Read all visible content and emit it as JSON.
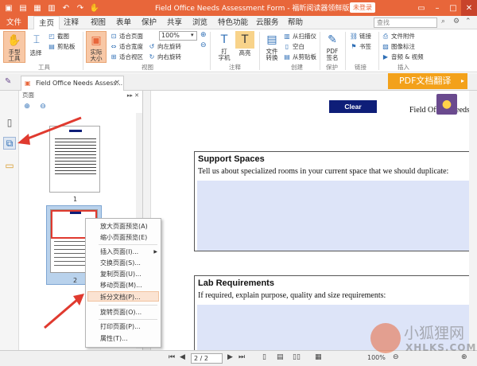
{
  "titlebar": {
    "title": "Field Office Needs Assessment Form - 福昕阅读器领鲜版",
    "login": "未登录",
    "icons": [
      "app-logo-icon",
      "open-icon",
      "save-icon",
      "print-icon",
      "undo-icon",
      "redo-icon",
      "hand-icon"
    ]
  },
  "menu": {
    "file": "文件",
    "tabs": [
      "主页",
      "注释",
      "视图",
      "表单",
      "保护",
      "共享",
      "浏览",
      "特色功能",
      "云服务",
      "帮助"
    ],
    "search_placeholder": "查找"
  },
  "ribbon": {
    "hand_tool": "手型\n工具",
    "select": "选择",
    "screenshot": "截图",
    "clipboard": "剪贴板",
    "tools_group": "工具",
    "actual_size": "实际\n大小",
    "fit_page": "适合页面",
    "fit_width": "适合宽度",
    "fit_visible": "适合视区",
    "zoom": "100%",
    "rotate_left": "向左旋转",
    "rotate_right": "向右旋转",
    "view_group": "视图",
    "typewriter": "打\n字机",
    "highlight": "高亮",
    "comment_group": "注释",
    "file_convert": "文件\n转换",
    "from_scanner": "从扫描仪",
    "blank": "空白",
    "from_clipboard": "从剪贴板",
    "create_group": "创建",
    "pdf_sign": "PDF\n签名",
    "protect_group": "保护",
    "link": "链接",
    "bookmark": "书签",
    "links_group": "链接",
    "file_attach": "文件附件",
    "image_annot": "图像标注",
    "audio_video": "音频 & 视频",
    "insert_group": "插入"
  },
  "doc_tab": {
    "name": "Field Office Needs Assess...",
    "close": "×"
  },
  "pdf_translate": "PDF文档翻译",
  "panel": {
    "title": "页面",
    "page1": "1",
    "page2": "2"
  },
  "document": {
    "clear_button": "Clear",
    "title": "Field Office Needs",
    "sections": [
      {
        "heading": "Support Spaces",
        "text": "Tell us about specialized rooms in your current space that we should duplicate:"
      },
      {
        "heading": "Lab Requirements",
        "text": "If required, explain purpose, quality and size requirements:"
      }
    ]
  },
  "context_menu": {
    "items": [
      "放大页面预览(A)",
      "缩小页面预览(E)",
      "插入页面(I)...",
      "交换页面(S)...",
      "复制页面(U)...",
      "移动页面(M)...",
      "拆分文档(P)...",
      "旋转页面(O)...",
      "打印页面(P)...",
      "属性(T)..."
    ],
    "highlighted_index": 6
  },
  "statusbar": {
    "page": "2 / 2",
    "zoom": "100%"
  },
  "watermark": {
    "main": "小狐狸网",
    "sub": "XHLKS.COM"
  },
  "colors": {
    "accent": "#e8663a",
    "translate": "#f3a11a",
    "clear_button": "#0e1e78",
    "field_fill": "#dde4f8",
    "annotation_red": "#e03a2f"
  }
}
